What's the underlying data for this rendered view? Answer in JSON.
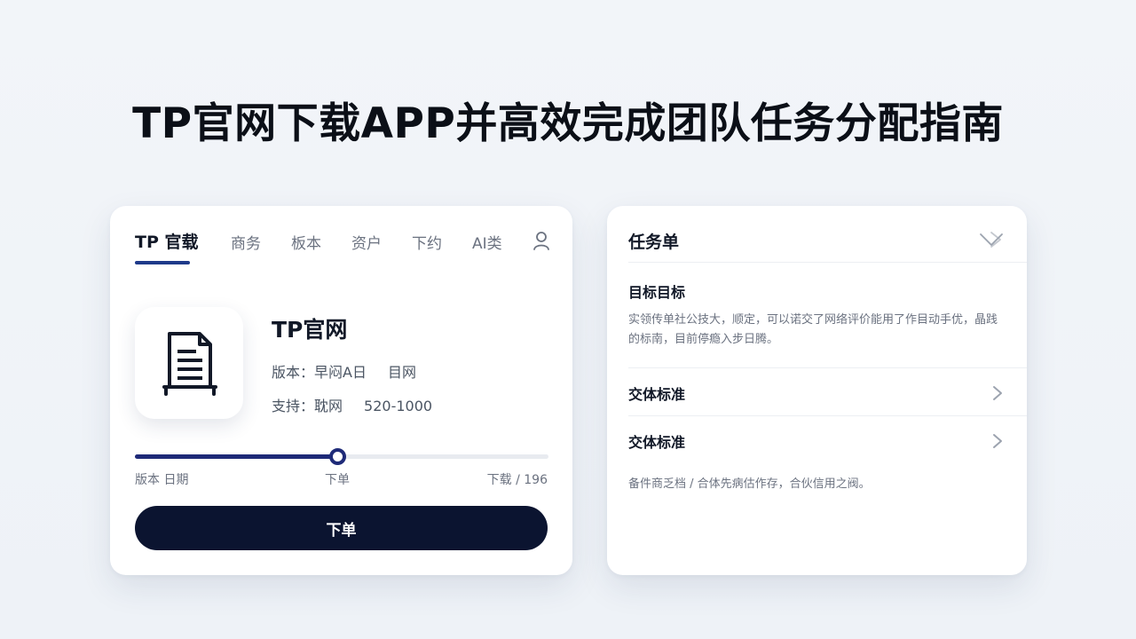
{
  "headline": "TP官网下载APP并高效完成团队任务分配指南",
  "left_card": {
    "tabs": [
      {
        "label": "TP 官载",
        "active": true
      },
      {
        "label": "商务",
        "active": false
      },
      {
        "label": "板本",
        "active": false
      },
      {
        "label": "资户",
        "active": false
      },
      {
        "label": "下约",
        "active": false
      },
      {
        "label": "AI类",
        "active": false
      }
    ],
    "user_icon": "user-icon",
    "app_icon": "document-icon",
    "app_name": "TP官网",
    "info": {
      "version_label": "版本：",
      "version_value": "早闷A日",
      "version_extra": "目网",
      "support_label": "支持：",
      "support_value": "耽网",
      "support_extra": "520-1000"
    },
    "progress": {
      "fraction": 0.49,
      "left_label": "版本  日期",
      "mid_label": "下单",
      "right_label": "下载 / 196"
    },
    "cta_label": "下单"
  },
  "right_card": {
    "title": "任务单",
    "collapse_icon": "chevron-collapse-icon",
    "section_title": "目标目标",
    "section_desc": "实领传单社公技大，顺定，可以诺交了网络评价能用了作目动手优，晶践的标南，目前停瘾入步日腾。",
    "rows": [
      {
        "label": "交体标准",
        "icon": "chevron-right-icon"
      },
      {
        "label": "交体标准",
        "icon": "chevron-right-icon"
      }
    ],
    "footer": "备件商乏档 / 合体先病估作存，合伙信用之阀。"
  },
  "colors": {
    "accent": "#1e2a78",
    "cta_bg": "#0b1430",
    "page_bg": "#eef2f7"
  }
}
